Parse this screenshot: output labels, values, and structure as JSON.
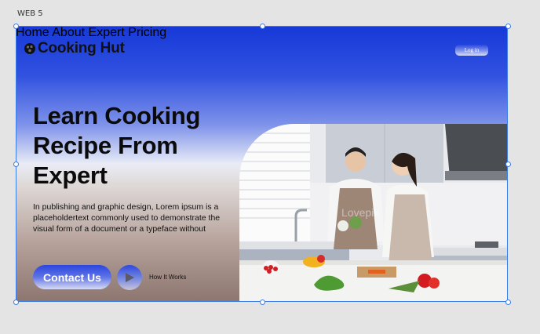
{
  "artboard": {
    "label": "WEB 5"
  },
  "brand": {
    "name": "Cooking Hut",
    "icon": "chef-logo-icon"
  },
  "nav": {
    "items": [
      "Home",
      "About",
      "Expert",
      "Pricing"
    ],
    "login_label": "Log in"
  },
  "hero": {
    "title_line1": "Learn Cooking",
    "title_line2": "Recipe From",
    "title_line3": "Expert",
    "desc_line1": "In publishing and graphic design, Lorem ipsum is a",
    "desc_line2": "placeholdertext commonly used to demonstrate the",
    "desc_line3": "visual form of a document or a typeface without",
    "contact_label": "Contact Us",
    "how_label": "How It Works"
  },
  "photo": {
    "watermark": "Lovepik",
    "subject": "couple-cooking-in-kitchen"
  },
  "colors": {
    "primary": "#1638d8",
    "selection": "#3b7de8",
    "canvas": "#e4e4e4"
  }
}
